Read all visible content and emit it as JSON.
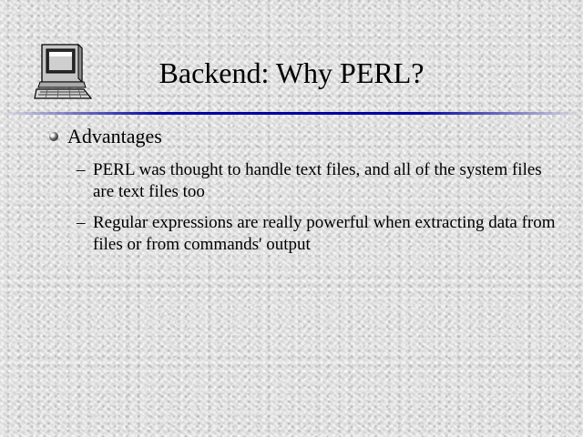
{
  "slide": {
    "title": "Backend: Why PERL?",
    "icon": "computer-icon",
    "accent_color": "#0000a0",
    "bullets": [
      {
        "text": "Advantages",
        "sub_bullets": [
          {
            "dash": "–",
            "text": "PERL was thought to handle text files, and all of the system files are text files too"
          },
          {
            "dash": "–",
            "text": "Regular expressions are really powerful when extracting data from files or from commands' output"
          }
        ]
      }
    ]
  }
}
